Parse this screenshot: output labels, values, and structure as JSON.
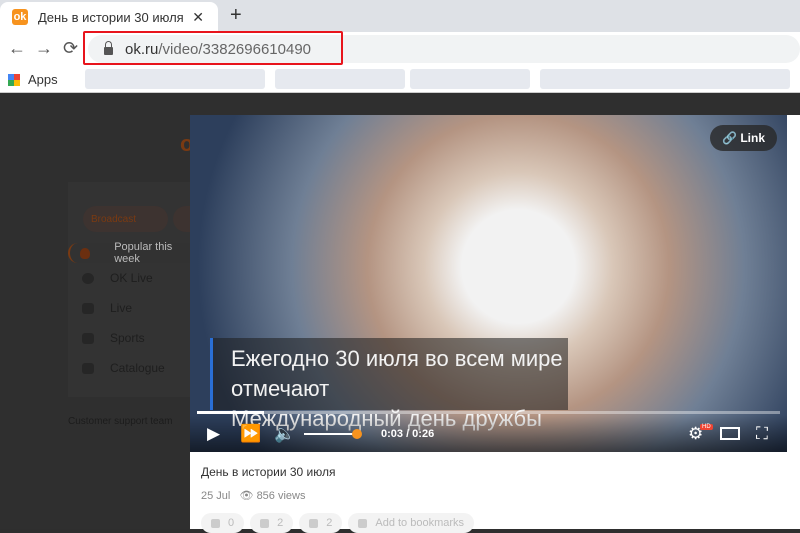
{
  "browser": {
    "tab_title": "День в истории 30 июля",
    "tab_close": "✕",
    "new_tab": "+",
    "back": "←",
    "forward": "→",
    "reload": "⟳",
    "url_host": "ok.ru",
    "url_path": "/video/3382696610490",
    "apps_label": "Apps"
  },
  "sidebar": {
    "logo": "ok",
    "broadcast": "Broadcast",
    "items": [
      {
        "label": "Popular this week",
        "icon": "fire-icon"
      },
      {
        "label": "OK Live",
        "icon": "live-circle-icon"
      },
      {
        "label": "Live",
        "icon": "camera-icon"
      },
      {
        "label": "Sports",
        "icon": "sports-icon"
      },
      {
        "label": "Catalogue",
        "icon": "catalogue-icon"
      }
    ],
    "support": "Customer support team"
  },
  "player": {
    "link_label": "Link",
    "caption_line1": "Ежегодно 30 июля во всем мире отмечают",
    "caption_line2": "Международный день дружбы",
    "time": "0:03 / 0:26",
    "progress": 0.115,
    "volume": 1.0,
    "quality_badge": "HD",
    "accent": "#f7931e"
  },
  "video": {
    "title": "День в истории 30 июля",
    "date": "25 Jul",
    "views": "856 views",
    "comments": "0",
    "shares": "2",
    "likes": "2",
    "bookmark": "Add to bookmarks"
  }
}
